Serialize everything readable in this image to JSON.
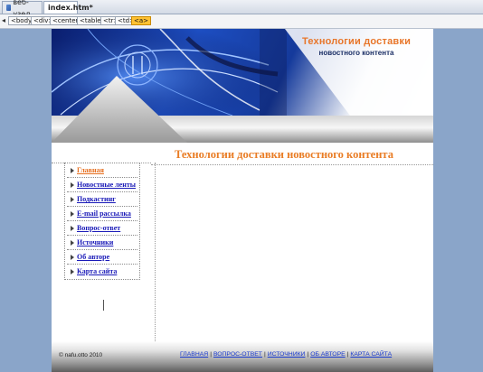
{
  "tabs": [
    {
      "label": "веб-узел"
    },
    {
      "label": "index.htm*"
    }
  ],
  "tagbar": {
    "tags": [
      "<body>",
      "<div>",
      "<center>",
      "<table>",
      "<tr>",
      "<td>",
      "<a>"
    ],
    "selected_index": 6
  },
  "banner": {
    "title": "Технологии доставки",
    "subtitle": "новостного контента"
  },
  "page_title": "Технологии доставки новостного контента",
  "nav": {
    "items": [
      {
        "label": "Главная",
        "active": true
      },
      {
        "label": "Новостные ленты"
      },
      {
        "label": "Подкастинг"
      },
      {
        "label": "E-mail рассылка"
      },
      {
        "label": "Вопрос-ответ"
      },
      {
        "label": "Источники"
      },
      {
        "label": "Об авторе"
      },
      {
        "label": "Карта сайта"
      }
    ]
  },
  "footer": {
    "copyright": "© nafu.otto 2010",
    "links": [
      "ГЛАВНАЯ",
      "ВОПРОС-ОТВЕТ",
      "ИСТОЧНИКИ",
      "ОБ АВТОРЕ",
      "КАРТА САЙТА"
    ],
    "separator": "|"
  },
  "colors": {
    "accent_orange": "#e97c24",
    "link_blue": "#1a1ab8",
    "banner_blue": "#1d4ec2",
    "editor_bg": "#8aa5c9"
  }
}
